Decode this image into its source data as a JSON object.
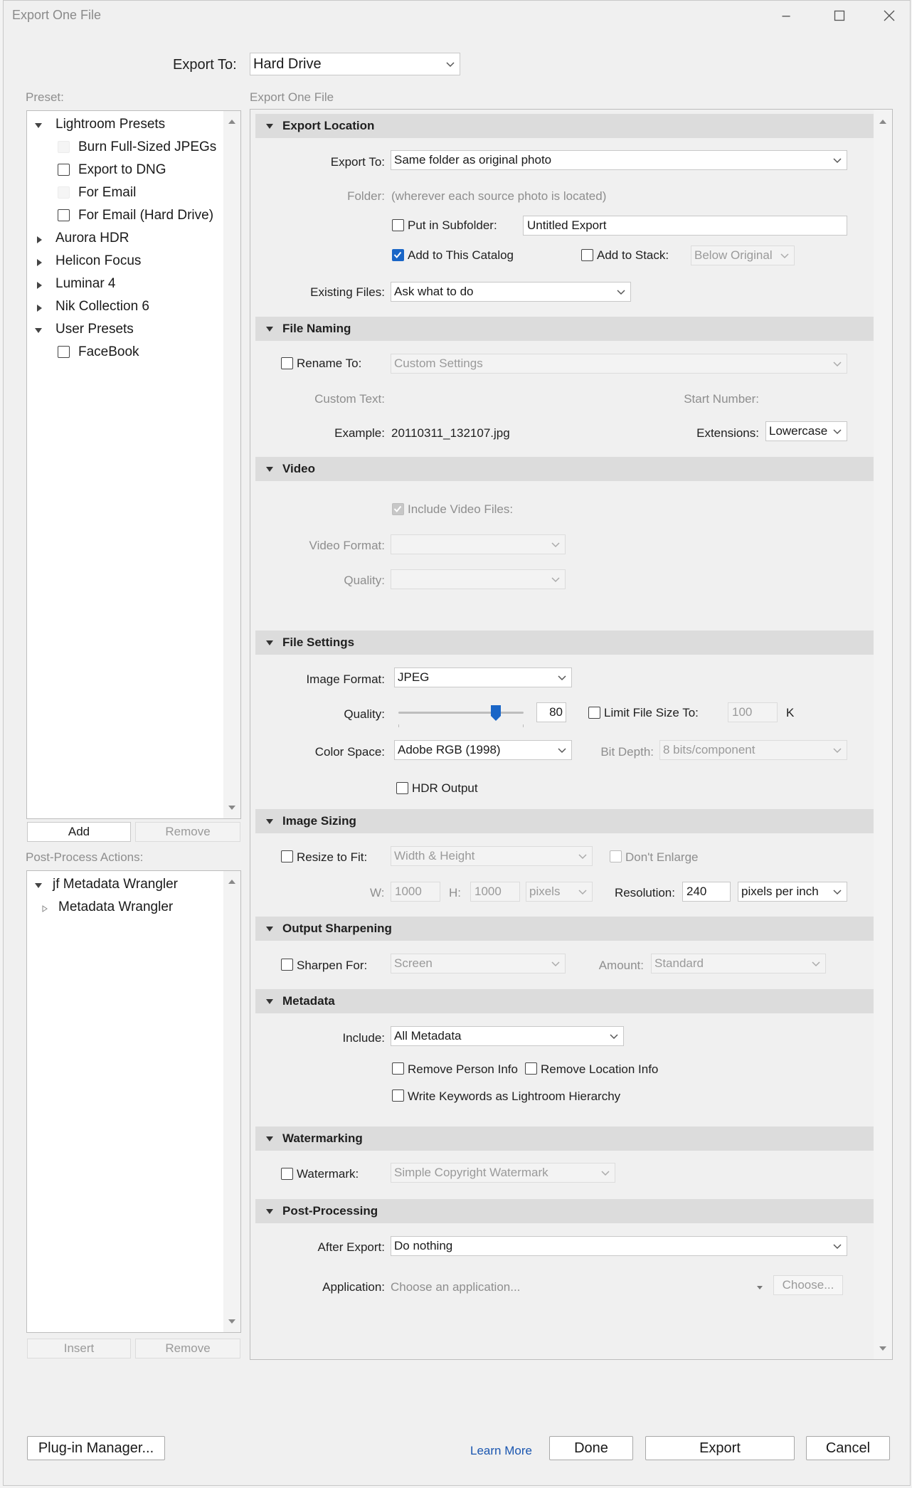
{
  "window": {
    "title": "Export One File"
  },
  "export_to": {
    "label": "Export To:",
    "value": "Hard Drive"
  },
  "preset": {
    "label": "Preset:",
    "groups": [
      {
        "name": "Lightroom Presets",
        "items": [
          "Burn Full-Sized JPEGs",
          "Export to DNG",
          "For Email",
          "For Email (Hard Drive)"
        ]
      },
      {
        "name": "Aurora HDR"
      },
      {
        "name": "Helicon Focus"
      },
      {
        "name": "Luminar 4"
      },
      {
        "name": "Nik Collection 6"
      },
      {
        "name": "User Presets",
        "items": [
          "FaceBook"
        ]
      }
    ],
    "add": "Add",
    "remove": "Remove"
  },
  "post_process": {
    "label": "Post-Process Actions:",
    "group": "jf Metadata Wrangler",
    "item": "Metadata Wrangler",
    "insert": "Insert",
    "remove": "Remove"
  },
  "right": {
    "header": "Export One File"
  },
  "export_location": {
    "title": "Export Location",
    "export_to_label": "Export To:",
    "export_to_value": "Same folder as original photo",
    "folder_label": "Folder:",
    "folder_value": "(wherever each source photo is located)",
    "subfolder_label": "Put in Subfolder:",
    "subfolder_value": "Untitled Export",
    "add_catalog_label": "Add to This Catalog",
    "add_stack_label": "Add to Stack:",
    "stack_value": "Below Original",
    "existing_label": "Existing Files:",
    "existing_value": "Ask what to do"
  },
  "file_naming": {
    "title": "File Naming",
    "rename_label": "Rename To:",
    "rename_value": "Custom Settings",
    "custom_text_label": "Custom Text:",
    "start_number_label": "Start Number:",
    "example_label": "Example:",
    "example_value": "20110311_132107.jpg",
    "extensions_label": "Extensions:",
    "extensions_value": "Lowercase"
  },
  "video": {
    "title": "Video",
    "include_label": "Include Video Files:",
    "format_label": "Video Format:",
    "quality_label": "Quality:"
  },
  "file_settings": {
    "title": "File Settings",
    "format_label": "Image Format:",
    "format_value": "JPEG",
    "quality_label": "Quality:",
    "quality_value": "80",
    "quality_fraction": 0.8,
    "limit_label": "Limit File Size To:",
    "limit_value": "100",
    "limit_unit": "K",
    "colorspace_label": "Color Space:",
    "colorspace_value": "Adobe RGB (1998)",
    "bitdepth_label": "Bit Depth:",
    "bitdepth_value": "8 bits/component",
    "hdr_label": "HDR Output"
  },
  "image_sizing": {
    "title": "Image Sizing",
    "resize_label": "Resize to Fit:",
    "resize_value": "Width & Height",
    "dont_enlarge_label": "Don't Enlarge",
    "w_label": "W:",
    "w_value": "1000",
    "h_label": "H:",
    "h_value": "1000",
    "unit_value": "pixels",
    "resolution_label": "Resolution:",
    "resolution_value": "240",
    "resolution_unit": "pixels per inch"
  },
  "output_sharpening": {
    "title": "Output Sharpening",
    "sharpen_label": "Sharpen For:",
    "sharpen_value": "Screen",
    "amount_label": "Amount:",
    "amount_value": "Standard"
  },
  "metadata": {
    "title": "Metadata",
    "include_label": "Include:",
    "include_value": "All Metadata",
    "remove_person": "Remove Person Info",
    "remove_location": "Remove Location Info",
    "write_keywords": "Write Keywords as Lightroom Hierarchy"
  },
  "watermarking": {
    "title": "Watermarking",
    "watermark_label": "Watermark:",
    "watermark_value": "Simple Copyright Watermark"
  },
  "post_processing": {
    "title": "Post-Processing",
    "after_label": "After Export:",
    "after_value": "Do nothing",
    "app_label": "Application:",
    "app_placeholder": "Choose an application...",
    "choose": "Choose..."
  },
  "footer": {
    "plugin": "Plug-in Manager...",
    "learn_more": "Learn More",
    "done": "Done",
    "export": "Export",
    "cancel": "Cancel"
  },
  "colors": {
    "accent": "#1a66c7",
    "section_bg": "#dcdcdc",
    "window_bg": "#f0f0f0"
  },
  "icons": [
    "minimize-icon",
    "maximize-icon",
    "close-icon",
    "chevron-down-icon",
    "disclosure-triangle-icon",
    "checkmark-icon",
    "scroll-arrow-icon"
  ]
}
